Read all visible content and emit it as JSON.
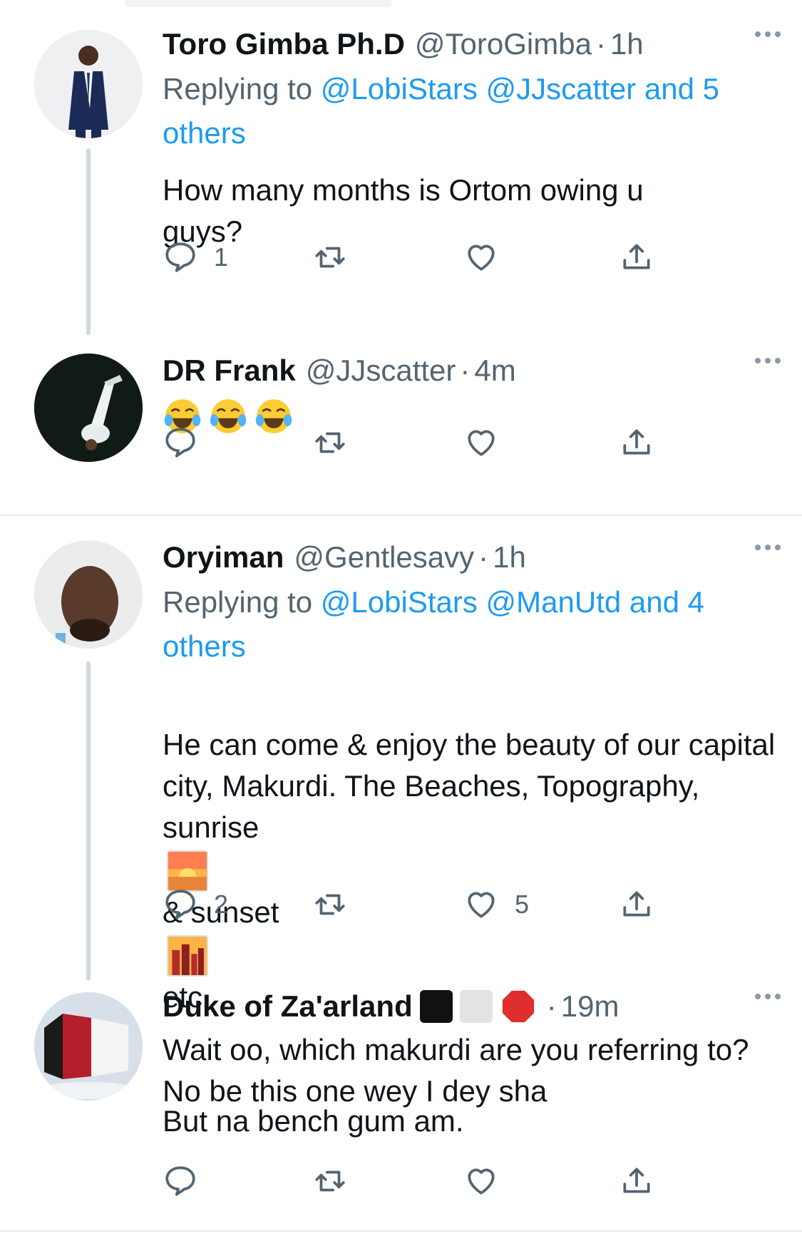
{
  "tweets": [
    {
      "name": "Toro Gimba Ph.D",
      "handle": "@ToroGimba",
      "dot": "·",
      "time": "1h",
      "reply_prefix": "Replying to",
      "reply_targets": "@LobiStars @JJscatter and 5 others",
      "text": "How many months is Ortom owing u guys?",
      "reply_count": "1",
      "retweet_count": "",
      "like_count": ""
    },
    {
      "name": "DR Frank",
      "handle": "@JJscatter",
      "dot": "·",
      "time": "4m",
      "emojis": [
        "face-with-tears-of-joy",
        "face-with-tears-of-joy",
        "face-with-tears-of-joy"
      ],
      "reply_count": "",
      "retweet_count": "",
      "like_count": ""
    },
    {
      "name": "Oryiman",
      "handle": "@Gentlesavy",
      "dot": "·",
      "time": "1h",
      "reply_prefix": "Replying to",
      "reply_targets": "@LobiStars @ManUtd and 4 others",
      "text_line1": "He can come & enjoy the beauty of our capital city, Makurdi. The Beaches, Topography, sunrise",
      "text_mid": "& sunset",
      "text_end": "etc.",
      "text_line2": "But na bench gum am.",
      "reply_count": "2",
      "retweet_count": "",
      "like_count": "5"
    },
    {
      "name": "Duke of Za'arland",
      "handle": "",
      "dot": "·",
      "time": "19m",
      "text": "Wait oo, which makurdi are you referring to?\nNo be this one wey I dey sha",
      "reply_count": "",
      "retweet_count": "",
      "like_count": ""
    }
  ],
  "icons": {
    "reply": "reply-icon",
    "retweet": "retweet-icon",
    "like": "heart-icon",
    "share": "share-icon",
    "more": "more-icon"
  },
  "colors": {
    "link": "#1d9bf0",
    "secondary": "#536471",
    "thread_line": "#cfd9de"
  }
}
